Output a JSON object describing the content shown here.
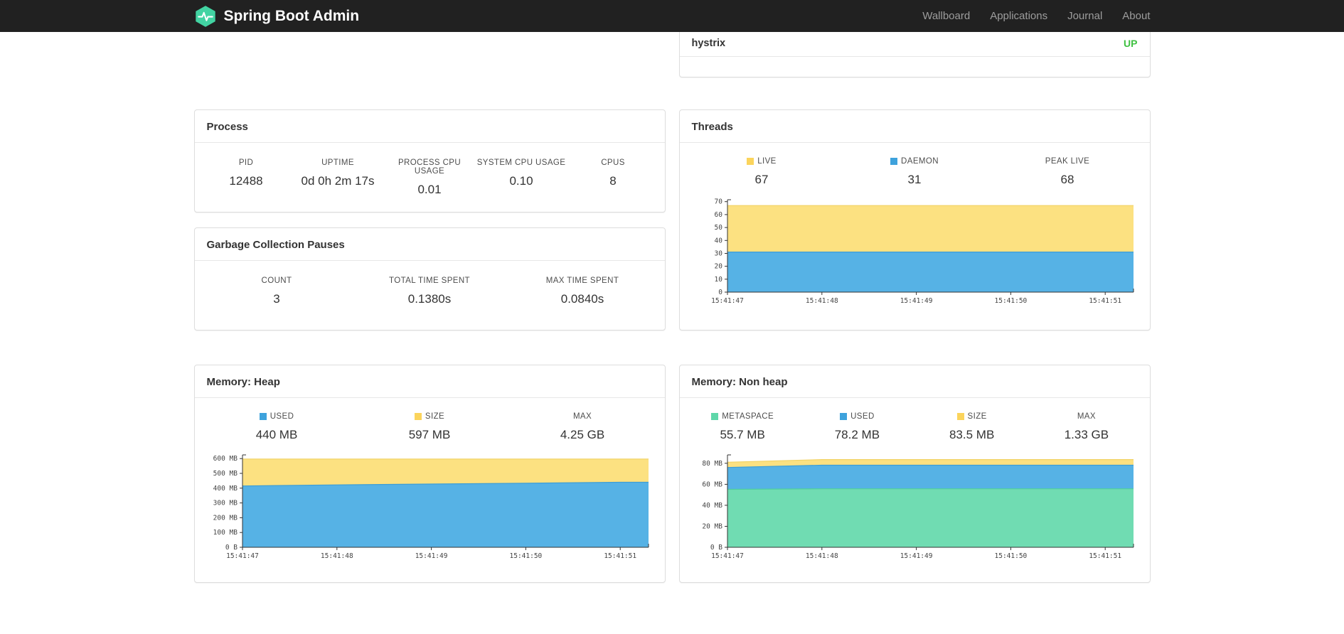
{
  "navbar": {
    "brand": "Spring Boot Admin",
    "brand_icon": "pulse-hexagon-icon",
    "brand_color": "#42d3a2",
    "items": [
      {
        "label": "Wallboard"
      },
      {
        "label": "Applications"
      },
      {
        "label": "Journal"
      },
      {
        "label": "About"
      }
    ]
  },
  "status_panel": {
    "service": "hystrix",
    "status": "UP",
    "status_color": "#3fc142"
  },
  "process": {
    "title": "Process",
    "stats": [
      {
        "label": "PID",
        "value": "12488"
      },
      {
        "label": "UPTIME",
        "value": "0d 0h 2m 17s"
      },
      {
        "label": "PROCESS CPU USAGE",
        "value": "0.01"
      },
      {
        "label": "SYSTEM CPU USAGE",
        "value": "0.10"
      },
      {
        "label": "CPUS",
        "value": "8"
      }
    ]
  },
  "gc": {
    "title": "Garbage Collection Pauses",
    "stats": [
      {
        "label": "COUNT",
        "value": "3"
      },
      {
        "label": "TOTAL TIME SPENT",
        "value": "0.1380s"
      },
      {
        "label": "MAX TIME SPENT",
        "value": "0.0840s"
      }
    ]
  },
  "threads": {
    "title": "Threads",
    "legend": [
      {
        "label": "LIVE",
        "value": "67",
        "color": "#fbd45c"
      },
      {
        "label": "DAEMON",
        "value": "31",
        "color": "#3ea2dc"
      },
      {
        "label": "PEAK LIVE",
        "value": "68",
        "color": null
      }
    ]
  },
  "heap": {
    "title": "Memory: Heap",
    "legend": [
      {
        "label": "USED",
        "value": "440 MB",
        "color": "#3ea2dc"
      },
      {
        "label": "SIZE",
        "value": "597 MB",
        "color": "#fbd45c"
      },
      {
        "label": "MAX",
        "value": "4.25 GB",
        "color": null
      }
    ]
  },
  "nonheap": {
    "title": "Memory: Non heap",
    "legend": [
      {
        "label": "METASPACE",
        "value": "55.7 MB",
        "color": "#5fd7a9"
      },
      {
        "label": "USED",
        "value": "78.2 MB",
        "color": "#3ea2dc"
      },
      {
        "label": "SIZE",
        "value": "83.5 MB",
        "color": "#fbd45c"
      },
      {
        "label": "MAX",
        "value": "1.33 GB",
        "color": null
      }
    ]
  },
  "chart_data": [
    {
      "id": "threads",
      "type": "area",
      "title": "Threads",
      "x_labels": [
        "15:41:47",
        "15:41:48",
        "15:41:49",
        "15:41:50",
        "15:41:51"
      ],
      "ylim": [
        0,
        71.5
      ],
      "y_ticks": [
        {
          "v": 0,
          "t": "0"
        },
        {
          "v": 10,
          "t": "10"
        },
        {
          "v": 20,
          "t": "20"
        },
        {
          "v": 30,
          "t": "30"
        },
        {
          "v": 40,
          "t": "40"
        },
        {
          "v": 50,
          "t": "50"
        },
        {
          "v": 60,
          "t": "60"
        },
        {
          "v": 70,
          "t": "70"
        }
      ],
      "series": [
        {
          "name": "LIVE",
          "fill": "#fce181",
          "stroke": "#f1d264",
          "values": [
            67,
            67,
            67,
            67,
            67
          ]
        },
        {
          "name": "DAEMON",
          "fill": "#56b2e5",
          "stroke": "#3e9ed5",
          "values": [
            31,
            31,
            31,
            31,
            31
          ]
        }
      ],
      "legend_position": "top",
      "grid": false
    },
    {
      "id": "heap",
      "type": "area",
      "title": "Memory: Heap",
      "x_labels": [
        "15:41:47",
        "15:41:48",
        "15:41:49",
        "15:41:50",
        "15:41:51"
      ],
      "ylim": [
        0,
        625
      ],
      "y_ticks": [
        {
          "v": 0,
          "t": "0 B"
        },
        {
          "v": 100,
          "t": "100 MB"
        },
        {
          "v": 200,
          "t": "200 MB"
        },
        {
          "v": 300,
          "t": "300 MB"
        },
        {
          "v": 400,
          "t": "400 MB"
        },
        {
          "v": 500,
          "t": "500 MB"
        },
        {
          "v": 600,
          "t": "600 MB"
        }
      ],
      "series": [
        {
          "name": "SIZE",
          "fill": "#fce181",
          "stroke": "#f1d264",
          "values": [
            597,
            597,
            597,
            597,
            597
          ]
        },
        {
          "name": "USED",
          "fill": "#56b2e5",
          "stroke": "#3e9ed5",
          "values": [
            415,
            422,
            428,
            433,
            440
          ]
        }
      ],
      "legend_position": "top",
      "grid": false
    },
    {
      "id": "nonheap",
      "type": "area",
      "title": "Memory: Non heap",
      "x_labels": [
        "15:41:47",
        "15:41:48",
        "15:41:49",
        "15:41:50",
        "15:41:51"
      ],
      "ylim": [
        0,
        88
      ],
      "y_ticks": [
        {
          "v": 0,
          "t": "0 B"
        },
        {
          "v": 20,
          "t": "20 MB"
        },
        {
          "v": 40,
          "t": "40 MB"
        },
        {
          "v": 60,
          "t": "60 MB"
        },
        {
          "v": 80,
          "t": "80 MB"
        }
      ],
      "series": [
        {
          "name": "SIZE",
          "fill": "#fce181",
          "stroke": "#f1d264",
          "values": [
            81,
            83.5,
            83.5,
            83.5,
            83.5
          ]
        },
        {
          "name": "USED",
          "fill": "#56b2e5",
          "stroke": "#3e9ed5",
          "values": [
            76,
            78.2,
            78.2,
            78.2,
            78.2
          ]
        },
        {
          "name": "METASPACE",
          "fill": "#70dcb2",
          "stroke": "#4fcf9e",
          "values": [
            55.2,
            55.7,
            55.7,
            55.7,
            55.7
          ]
        }
      ],
      "legend_position": "top",
      "grid": false
    }
  ]
}
